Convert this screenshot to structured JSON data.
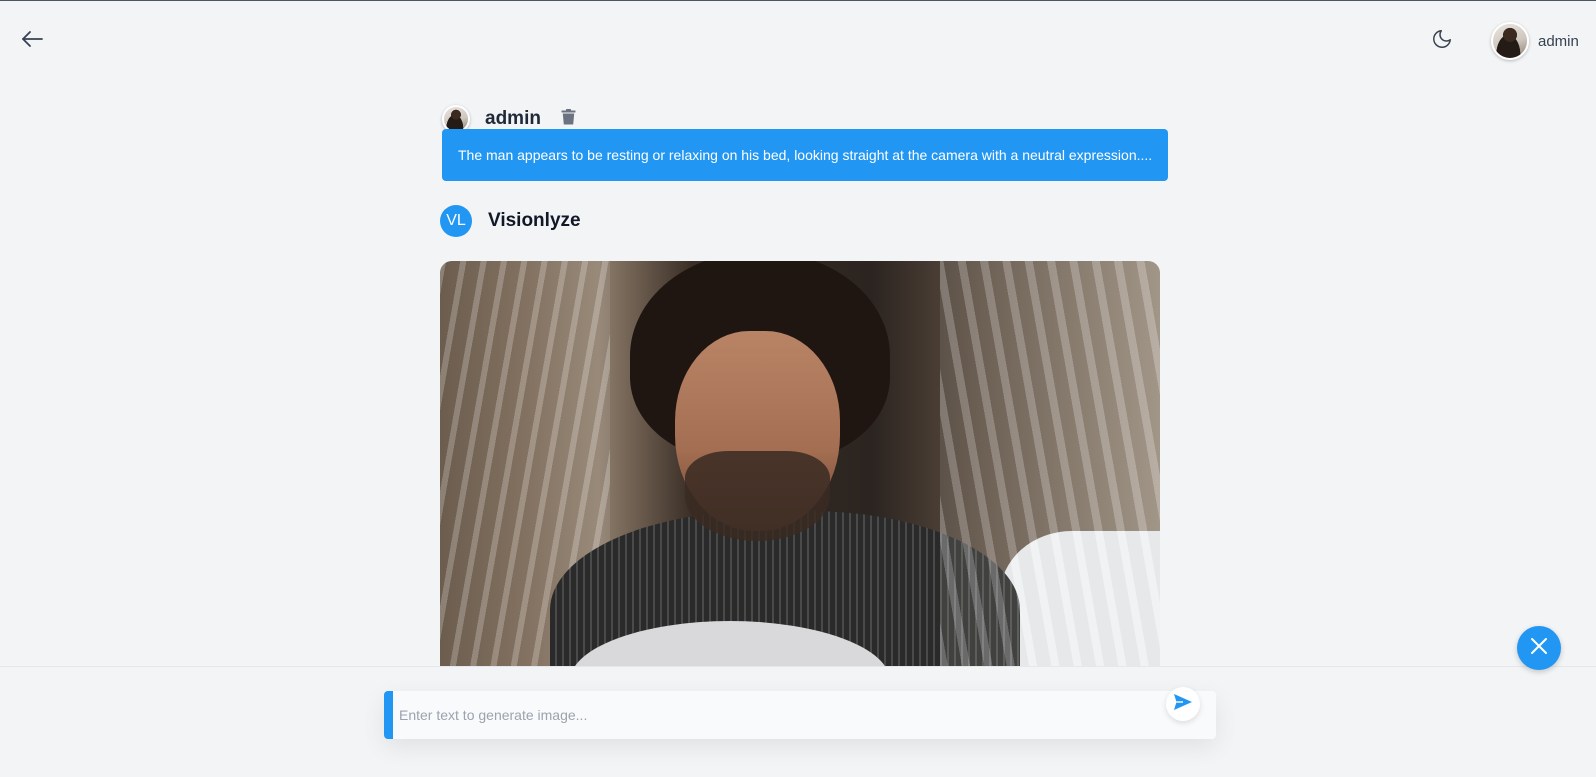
{
  "header": {
    "back_icon": "arrow-left-icon",
    "theme_icon": "moon-icon",
    "user": {
      "name": "admin"
    }
  },
  "conversation": {
    "user_message": {
      "author": "admin",
      "delete_icon": "trash-icon",
      "text": "The man appears to be resting or relaxing on his bed, looking straight at the camera with a neutral expression...."
    },
    "bot_message": {
      "badge": "VL",
      "author": "Visionlyze"
    }
  },
  "composer": {
    "placeholder": "Enter text to generate image...",
    "value": "",
    "send_icon": "send-icon"
  },
  "fab": {
    "icon": "close-icon"
  },
  "colors": {
    "accent": "#2196f3",
    "background": "#f3f4f6"
  }
}
